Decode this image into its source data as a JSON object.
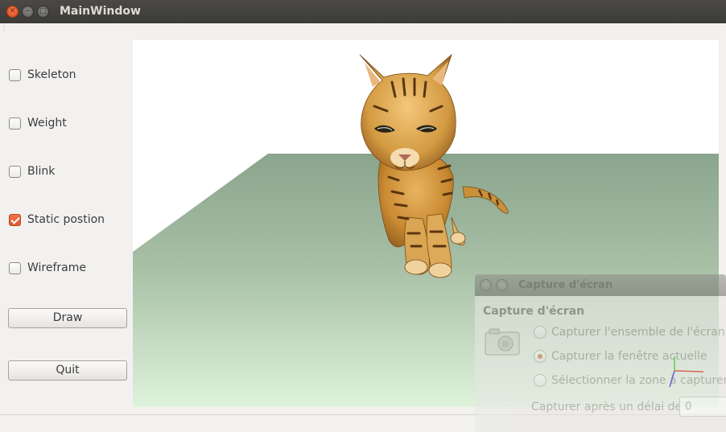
{
  "window": {
    "title": "MainWindow"
  },
  "controls": {
    "checkboxes": [
      {
        "label": "Skeleton",
        "checked": false
      },
      {
        "label": "Weight",
        "checked": false
      },
      {
        "label": "Blink",
        "checked": false
      },
      {
        "label": "Static postion",
        "checked": true
      },
      {
        "label": "Wireframe",
        "checked": false
      }
    ],
    "draw_label": "Draw",
    "quit_label": "Quit"
  },
  "viewport": {
    "scene": "3D cat model standing on a green plane",
    "colors": {
      "background": "#ffffff",
      "plane_far": "#8ba48d",
      "plane_near": "#dff2dc",
      "accent": "#e05a2e"
    }
  },
  "screenshot_dialog": {
    "title": "Capture d'écran",
    "heading": "Capture d'écran",
    "options": [
      {
        "label": "Capturer l'ensemble de l'écran",
        "selected": false
      },
      {
        "label": "Capturer la fenêtre actuelle",
        "selected": true
      },
      {
        "label": "Sélectionner la zone à capturer",
        "selected": false
      }
    ],
    "delay_label": "Capturer après un délai de",
    "delay_value": "0"
  }
}
